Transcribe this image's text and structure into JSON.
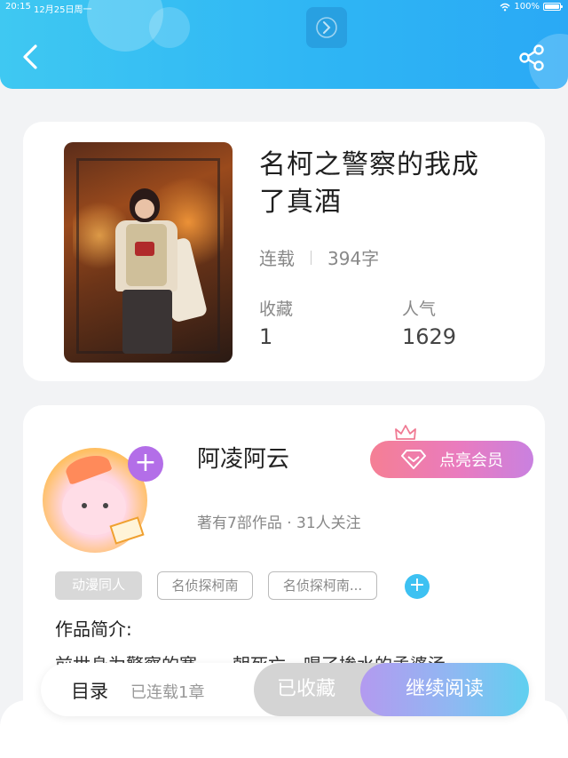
{
  "status_bar": {
    "time": "20:15",
    "date": "12月25日周一",
    "battery": "100%"
  },
  "header": {
    "back_icon": "chevron-left-icon",
    "share_icon": "share-icon",
    "center_icon": "chevron-right-icon",
    "gradient_start": "#3fc8f2",
    "gradient_end": "#2aa9f5"
  },
  "book": {
    "title_line1": "名柯之警察的我成",
    "title_line2": "了真酒",
    "status": "连载",
    "word_count": "394字",
    "favorites_label": "收藏",
    "favorites_value": "1",
    "popularity_label": "人气",
    "popularity_value": "1629"
  },
  "author": {
    "name": "阿凌阿云",
    "stats": "著有7部作品 · 31人关注",
    "follow_icon": "plus-icon",
    "vip_button": "点亮会员",
    "vip_icon": "diamond-icon",
    "crown_icon": "crown-icon"
  },
  "tags": [
    "动漫同人",
    "名侦探柯南",
    "名侦探柯南..."
  ],
  "intro": {
    "label": "作品简介:",
    "text": "前世身为警察的寒，一朝死亡，喝了掺水的孟婆汤"
  },
  "bottom_bar": {
    "toc_label": "目录",
    "toc_status": "已连载1章",
    "collected_button": "已收藏",
    "read_button": "继续阅读"
  },
  "colors": {
    "accent_blue": "#3dc1f2",
    "vip_pink": "#f57f94",
    "follow_purple": "#b36ee8",
    "read_gradient_start": "#b39af0",
    "read_gradient_end": "#5fd0f0"
  }
}
